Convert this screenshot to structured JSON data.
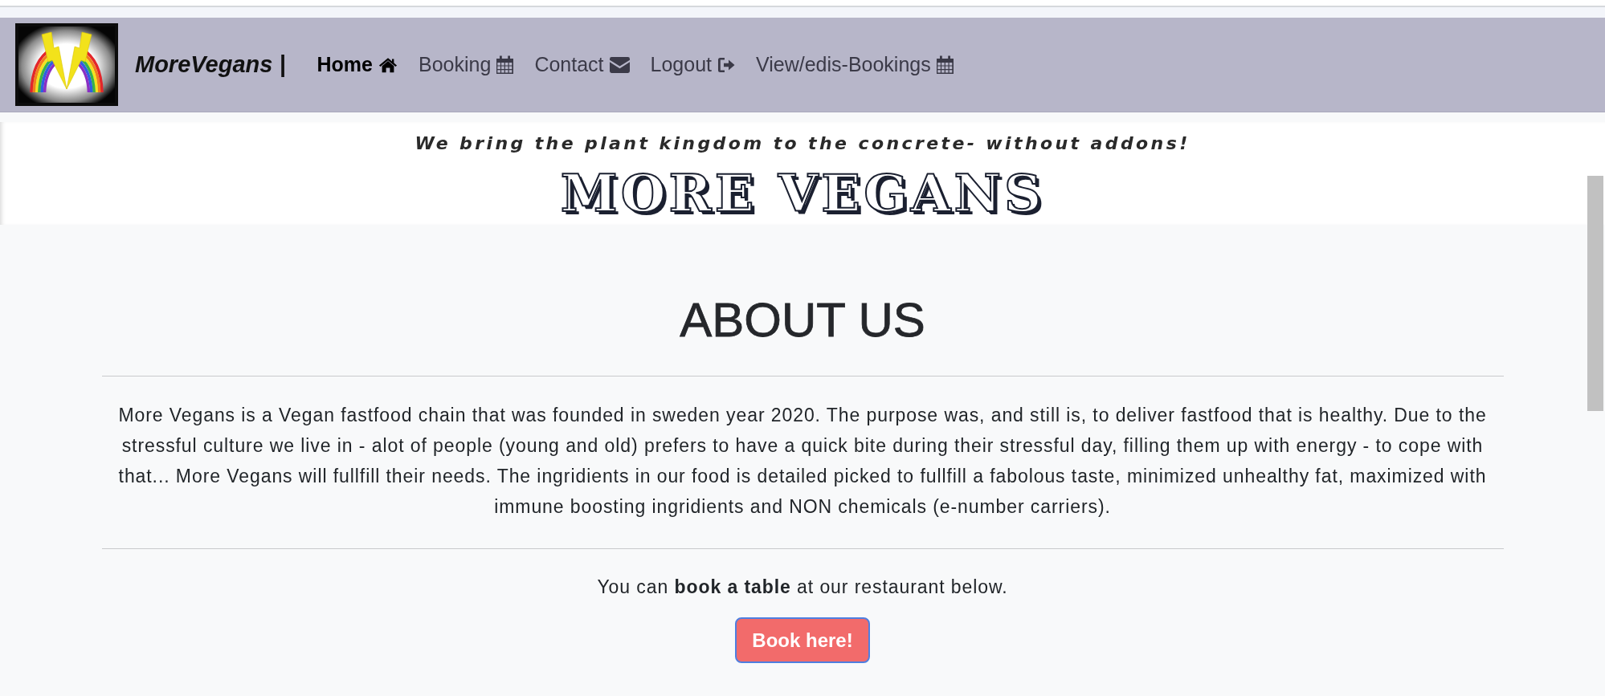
{
  "navbar": {
    "brand": "MoreVegans |",
    "links": [
      {
        "label": "Home",
        "kind": "home",
        "selected": true
      },
      {
        "label": "Booking",
        "kind": "calendar",
        "selected": false
      },
      {
        "label": "Contact",
        "kind": "envelope",
        "selected": false
      },
      {
        "label": "Logout",
        "kind": "logout",
        "selected": false
      },
      {
        "label": "View/edis-Bookings",
        "kind": "calendar",
        "selected": false
      }
    ]
  },
  "banner": {
    "tagline": "We bring the plant kingdom to the concrete- without addons!",
    "title": "MORE VEGANS"
  },
  "about": {
    "heading": "ABOUT US",
    "text": "More Vegans is a Vegan fastfood chain that was founded in sweden year 2020. The purpose was, and still is, to deliver fastfood that is healthy. Due to the stressful culture we live in - alot of people (young and old) prefers to have a quick bite during their stressful day, filling them up with energy - to cope with that... More Vegans will fullfill their needs. The ingridients in our food is detailed picked to fullfill a fabolous taste, minimized unhealthy fat, maximized with immune boosting ingridients and NON chemicals (e-number carriers).",
    "cta_text": "You can **book a table** at our restaurant below.",
    "button": "Book here!"
  }
}
